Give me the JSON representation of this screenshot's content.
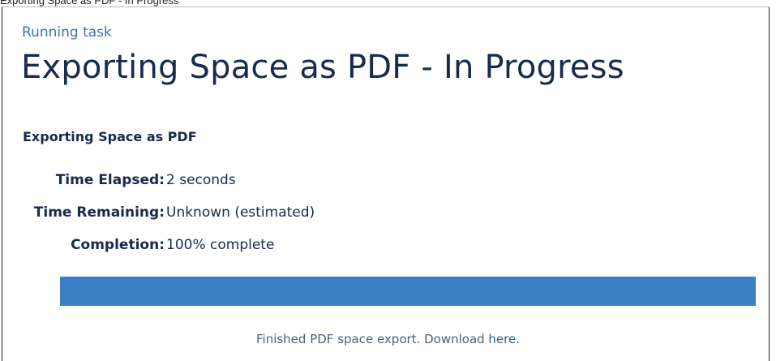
{
  "top_caption": "Exporting Space as PDF - In Progress",
  "breadcrumb": {
    "running_task_link": "Running task"
  },
  "page": {
    "title": "Exporting Space as PDF - In Progress",
    "task_heading": "Exporting Space as PDF"
  },
  "stats": {
    "time_elapsed_label": "Time Elapsed:",
    "time_elapsed_value": "2 seconds",
    "time_remaining_label": "Time Remaining:",
    "time_remaining_value": "Unknown (estimated)",
    "completion_label": "Completion:",
    "completion_value": "100% complete"
  },
  "progress": {
    "fraction": 1.0,
    "fill_color": "#3b7fc4"
  },
  "footer": {
    "message_prefix": "Finished PDF space export. Download ",
    "download_link": "here",
    "message_suffix": "."
  },
  "colors": {
    "link": "#3b73af",
    "title": "#172b4d"
  }
}
